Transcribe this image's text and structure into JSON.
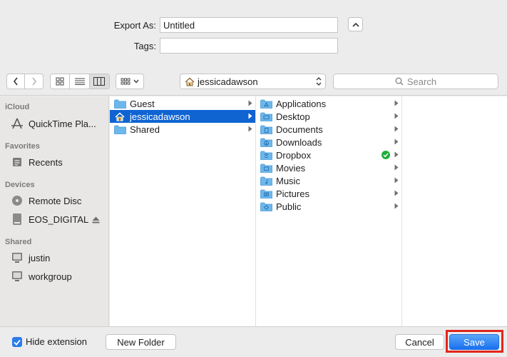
{
  "export_as": {
    "label": "Export As:",
    "value": "Untitled"
  },
  "tags": {
    "label": "Tags:",
    "value": ""
  },
  "toolbar": {
    "location": "jessicadawson",
    "search_placeholder": "Search"
  },
  "sidebar": {
    "sections": [
      {
        "title": "iCloud",
        "items": [
          {
            "label": "QuickTime Pla...",
            "icon": "app-store-icon"
          }
        ]
      },
      {
        "title": "Favorites",
        "items": [
          {
            "label": "Recents",
            "icon": "recents-icon"
          }
        ]
      },
      {
        "title": "Devices",
        "items": [
          {
            "label": "Remote Disc",
            "icon": "disc-icon"
          },
          {
            "label": "EOS_DIGITAL",
            "icon": "drive-icon"
          }
        ]
      },
      {
        "title": "Shared",
        "items": [
          {
            "label": "justin",
            "icon": "monitor-icon"
          },
          {
            "label": "workgroup",
            "icon": "monitor-icon"
          }
        ]
      }
    ]
  },
  "columns": {
    "col1": [
      {
        "label": "Guest",
        "icon": "folder-icon"
      },
      {
        "label": "jessicadawson",
        "icon": "home-icon",
        "selected": true
      },
      {
        "label": "Shared",
        "icon": "folder-icon"
      }
    ],
    "col2": [
      {
        "label": "Applications",
        "icon": "applications-folder-icon"
      },
      {
        "label": "Desktop",
        "icon": "desktop-folder-icon"
      },
      {
        "label": "Documents",
        "icon": "documents-folder-icon"
      },
      {
        "label": "Downloads",
        "icon": "downloads-folder-icon"
      },
      {
        "label": "Dropbox",
        "icon": "dropbox-folder-icon",
        "synced": true
      },
      {
        "label": "Movies",
        "icon": "movies-folder-icon"
      },
      {
        "label": "Music",
        "icon": "music-folder-icon"
      },
      {
        "label": "Pictures",
        "icon": "pictures-folder-icon"
      },
      {
        "label": "Public",
        "icon": "public-folder-icon"
      }
    ]
  },
  "bottom": {
    "hide_extension_label": "Hide extension",
    "hide_extension_checked": true,
    "new_folder_label": "New Folder",
    "cancel_label": "Cancel",
    "save_label": "Save"
  },
  "colors": {
    "accent": "#0f64d2",
    "highlight": "#e1261c",
    "folder": "#6cb7ec"
  }
}
